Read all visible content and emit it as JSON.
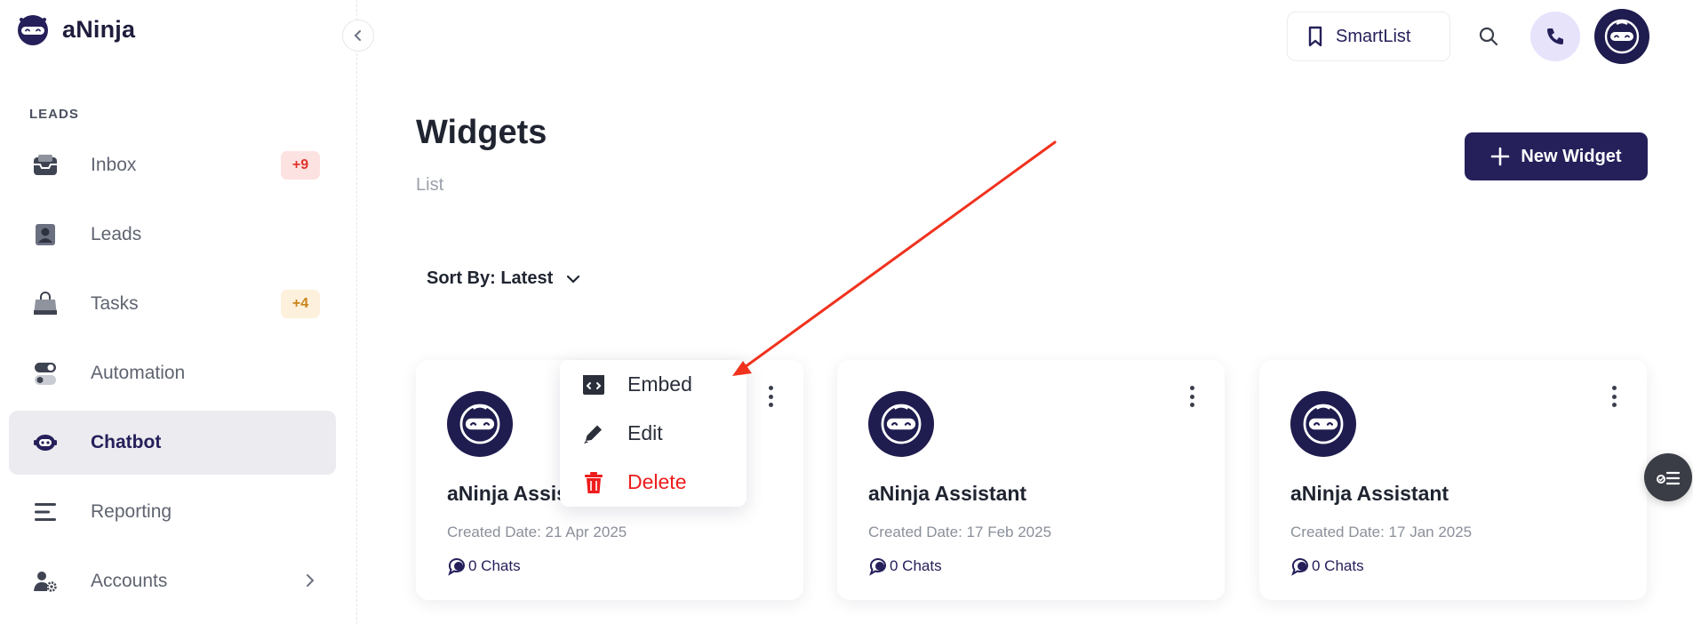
{
  "brand": {
    "name": "aNinja"
  },
  "sidebar": {
    "section_label": "LEADS",
    "items": [
      {
        "label": "Inbox",
        "icon": "inbox-icon",
        "badge": "+9"
      },
      {
        "label": "Leads",
        "icon": "contact-card-icon"
      },
      {
        "label": "Tasks",
        "icon": "shopping-bag-icon",
        "badge": "+4"
      },
      {
        "label": "Automation",
        "icon": "toggle-icon"
      },
      {
        "label": "Chatbot",
        "icon": "chatbot-icon",
        "active": true
      },
      {
        "label": "Reporting",
        "icon": "list-lines-icon"
      },
      {
        "label": "Accounts",
        "icon": "user-gear-icon",
        "has_submenu": true
      }
    ]
  },
  "header": {
    "smartlist_label": "SmartList"
  },
  "main": {
    "title": "Widgets",
    "subtitle": "List",
    "new_widget_label": "New Widget",
    "sort_label": "Sort By: Latest"
  },
  "cards": [
    {
      "title": "aNinja Assistant",
      "created": "Created Date: 21 Apr 2025",
      "chats": "0 Chats"
    },
    {
      "title": "aNinja Assistant",
      "created": "Created Date: 17 Feb 2025",
      "chats": "0 Chats"
    },
    {
      "title": "aNinja Assistant",
      "created": "Created Date: 17 Jan 2025",
      "chats": "0 Chats"
    }
  ],
  "context_menu": {
    "items": [
      {
        "label": "Embed",
        "icon": "code-embed-icon"
      },
      {
        "label": "Edit",
        "icon": "pencil-icon"
      },
      {
        "label": "Delete",
        "icon": "trash-icon"
      }
    ]
  },
  "colors": {
    "brand_navy": "#25205a",
    "danger": "#ee1c1c",
    "annotation_arrow": "#f0321e"
  }
}
